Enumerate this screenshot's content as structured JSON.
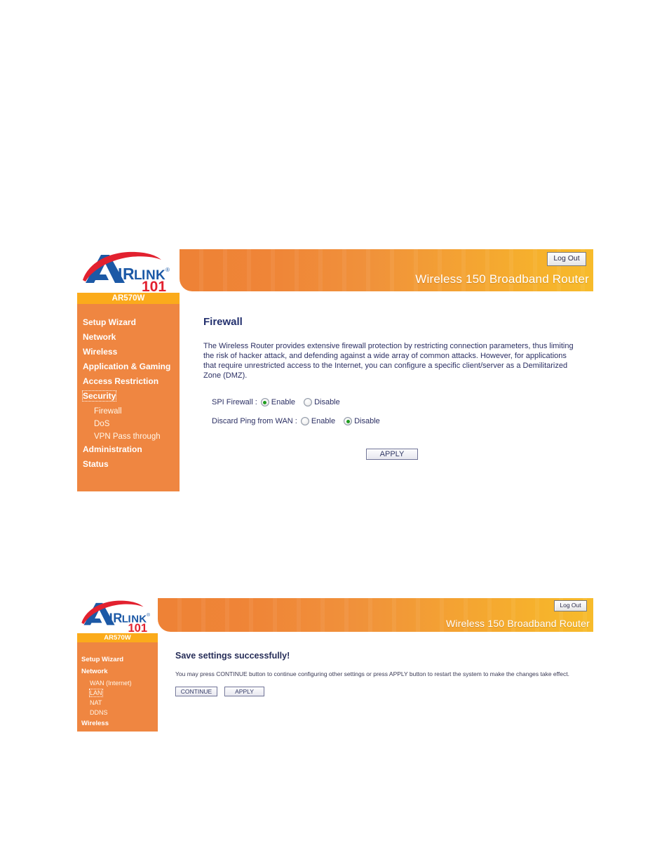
{
  "panels": [
    {
      "id": "firewall",
      "header": {
        "logout_label": "Log Out",
        "product_title": "Wireless 150 Broadband Router"
      },
      "sidebar": {
        "model": "AR570W",
        "items": [
          {
            "label": "Setup Wizard",
            "level": "top",
            "focused": false
          },
          {
            "label": "Network",
            "level": "top",
            "focused": false
          },
          {
            "label": "Wireless",
            "level": "top",
            "focused": false
          },
          {
            "label": "Application & Gaming",
            "level": "top",
            "focused": false
          },
          {
            "label": "Access Restriction",
            "level": "top",
            "focused": false
          },
          {
            "label": "Security",
            "level": "top",
            "focused": true
          },
          {
            "label": "Firewall",
            "level": "sub",
            "focused": false
          },
          {
            "label": "DoS",
            "level": "sub",
            "focused": false
          },
          {
            "label": "VPN Pass through",
            "level": "sub",
            "focused": false
          },
          {
            "label": "Administration",
            "level": "top",
            "focused": false
          },
          {
            "label": "Status",
            "level": "top",
            "focused": false
          }
        ]
      },
      "content": {
        "title": "Firewall",
        "description": "The Wireless Router provides extensive firewall protection by restricting connection parameters, thus limiting the risk of hacker attack, and defending against a wide array of common attacks. However, for applications that require unrestricted access to the Internet, you can configure a specific client/server as a Demilitarized Zone (DMZ).",
        "fields": [
          {
            "label": "SPI Firewall :",
            "options": [
              {
                "label": "Enable",
                "checked": true
              },
              {
                "label": "Disable",
                "checked": false
              }
            ]
          },
          {
            "label": "Discard Ping from WAN :",
            "options": [
              {
                "label": "Enable",
                "checked": false
              },
              {
                "label": "Disable",
                "checked": true
              }
            ]
          }
        ],
        "apply_label": "APPLY"
      }
    },
    {
      "id": "save-success",
      "header": {
        "logout_label": "Log Out",
        "product_title": "Wireless 150 Broadband Router"
      },
      "sidebar": {
        "model": "AR570W",
        "items": [
          {
            "label": "Setup Wizard",
            "level": "top",
            "focused": false
          },
          {
            "label": "Network",
            "level": "top",
            "focused": false
          },
          {
            "label": "WAN (Internet)",
            "level": "sub",
            "focused": false
          },
          {
            "label": "LAN",
            "level": "sub",
            "focused": true
          },
          {
            "label": "NAT",
            "level": "sub",
            "focused": false
          },
          {
            "label": "DDNS",
            "level": "sub",
            "focused": false
          },
          {
            "label": "Wireless",
            "level": "top",
            "focused": false
          }
        ]
      },
      "content": {
        "title": "Save settings successfully!",
        "description": "You may press CONTINUE button to continue configuring other settings or press APPLY button to restart the system to make the changes take effect.",
        "buttons": [
          {
            "label": "CONTINUE"
          },
          {
            "label": "APPLY"
          }
        ]
      }
    }
  ],
  "colors": {
    "sidebar_orange": "#ef8641",
    "model_bar_gold": "#fbab1b",
    "header_left": "#ee8236",
    "header_right": "#f7bb2b",
    "heading_navy": "#23306e",
    "radio_checked_green": "#1f9c1f",
    "logo_blue": "#1c59a6",
    "logo_red": "#e2212f"
  }
}
